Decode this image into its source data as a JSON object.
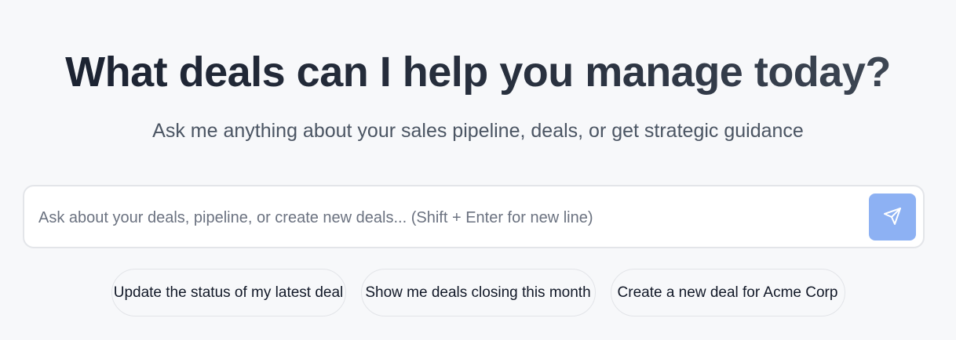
{
  "hero": {
    "title": "What deals can I help you manage today?",
    "subtitle": "Ask me anything about your sales pipeline, deals, or get strategic guidance"
  },
  "composer": {
    "value": "",
    "placeholder": "Ask about your deals, pipeline, or create new deals... (Shift + Enter for new line)",
    "send_icon": "send-icon",
    "send_button_color": "#8db1f3"
  },
  "suggestions": [
    {
      "label": "Update the status of my latest deal"
    },
    {
      "label": "Show me deals closing this month"
    },
    {
      "label": "Create a new deal for Acme Corp"
    }
  ],
  "colors": {
    "background": "#f7f8fa",
    "title": "#1a2130",
    "subtitle": "#4b5563",
    "placeholder": "#6b7280"
  }
}
